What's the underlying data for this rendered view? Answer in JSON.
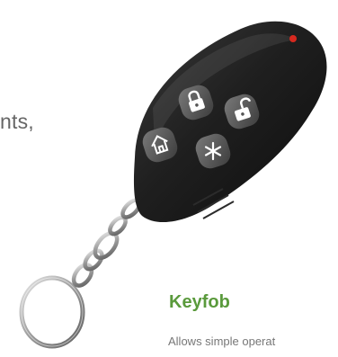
{
  "intro": {
    "partial_text": "nts,"
  },
  "product": {
    "title": "Keyfob",
    "description": "Allows simple operat"
  },
  "keyfob": {
    "buttons": [
      {
        "name": "lock-button",
        "icon": "lock-closed-icon"
      },
      {
        "name": "unlock-button",
        "icon": "lock-open-icon"
      },
      {
        "name": "home-button",
        "icon": "home-icon"
      },
      {
        "name": "star-button",
        "icon": "star-icon"
      }
    ],
    "colors": {
      "body": "#1b1b1b",
      "buttons": "#5a5a5a",
      "led": "#d6291f",
      "accent": "#5a9a3c"
    }
  }
}
